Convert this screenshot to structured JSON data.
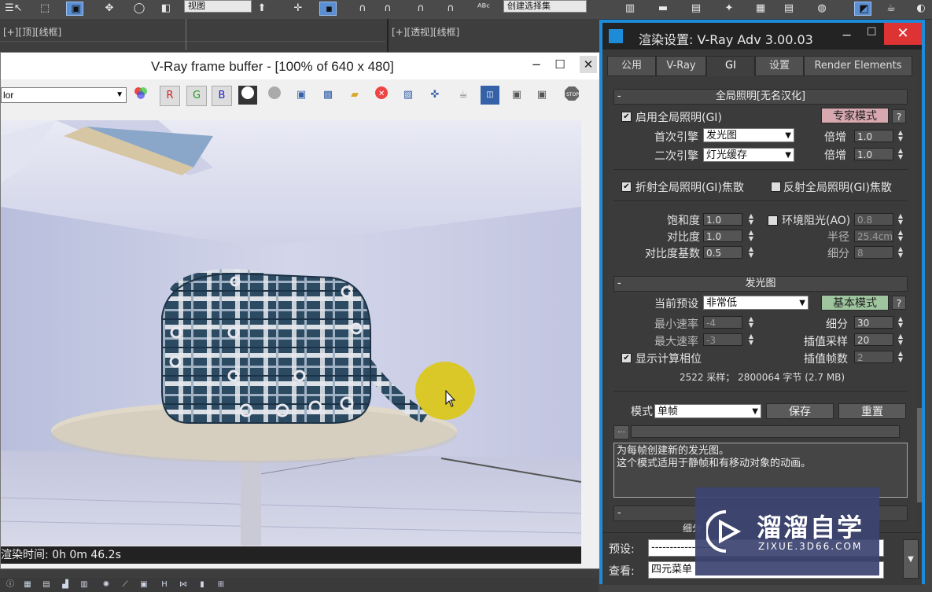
{
  "main_toolbar": {
    "view_dropdown": "视图",
    "named_selection_dropdown": "创建选择集"
  },
  "viewports": {
    "left_label": "[+][顶][线框]",
    "right_label": "[+][透视][线框]"
  },
  "frame_buffer": {
    "title": "V-Ray frame buffer - [100% of 640 x 480]",
    "channel_select": "lor",
    "channel_buttons": [
      "R",
      "G",
      "B"
    ],
    "status": "渲染时间:  0h  0m 46.2s"
  },
  "render_settings": {
    "title": "渲染设置: V-Ray Adv 3.00.03",
    "tabs": [
      "公用",
      "V-Ray",
      "GI",
      "设置",
      "Render Elements"
    ],
    "active_tab": "GI",
    "gi_rollout": {
      "title": "全局照明[无名汉化]",
      "enable_gi_label": "启用全局照明(GI)",
      "enable_gi_checked": true,
      "expert_mode_button": "专家模式",
      "help_button": "?",
      "primary_engine_label": "首次引擎",
      "primary_engine_value": "发光图",
      "primary_multiplier_label": "倍增",
      "primary_multiplier": "1.0",
      "secondary_engine_label": "二次引擎",
      "secondary_engine_value": "灯光缓存",
      "secondary_multiplier_label": "倍增",
      "secondary_multiplier": "1.0",
      "refractive_caustics_label": "折射全局照明(GI)焦散",
      "refractive_caustics_checked": true,
      "reflective_caustics_label": "反射全局照明(GI)焦散",
      "reflective_caustics_checked": false,
      "saturation_label": "饱和度",
      "saturation": "1.0",
      "contrast_label": "对比度",
      "contrast": "1.0",
      "contrast_base_label": "对比度基数",
      "contrast_base": "0.5",
      "ao_label": "环境阻光(AO)",
      "ao_checked": false,
      "ao_value": "0.8",
      "radius_label": "半径",
      "radius": "25.4cm",
      "subdivs_label": "细分",
      "subdivs": "8"
    },
    "irradiance_rollout": {
      "title": "发光图",
      "current_preset_label": "当前预设",
      "current_preset": "非常低",
      "basic_mode_button": "基本模式",
      "help_button": "?",
      "min_rate_label": "最小速率",
      "min_rate": "-4",
      "max_rate_label": "最大速率",
      "max_rate": "-3",
      "subdivs_label": "细分",
      "subdivs": "30",
      "interp_samples_label": "插值采样",
      "interp_samples": "20",
      "show_calc_phase_label": "显示计算相位",
      "show_calc_phase_checked": true,
      "interp_frames_label": "插值帧数",
      "interp_frames": "2",
      "stats": "2522 采样；  2800064 字节 (2.7 MB)",
      "mode_label": "模式",
      "mode_value": "单帧",
      "save_button": "保存",
      "reset_button": "重置",
      "browse_button": "...",
      "description_line1": "为每帧创建新的发光图。",
      "description_line2": "这个模式适用于静帧和有移动对象的动画。"
    },
    "next_rollout_fragment": "细分",
    "preset_label": "预设:",
    "preset_value": "--------------------",
    "view_label": "查看:",
    "view_value": "四元菜单"
  },
  "watermark": {
    "name": "溜溜自学",
    "url": "ZIXUE.3D66.COM"
  },
  "colors": {
    "dialog_border": "#1e8bd8",
    "close_red": "#d33333",
    "expert_pink": "#d8a8b0",
    "basic_green": "#9fc59f",
    "cursor_highlight": "#dcc814"
  }
}
